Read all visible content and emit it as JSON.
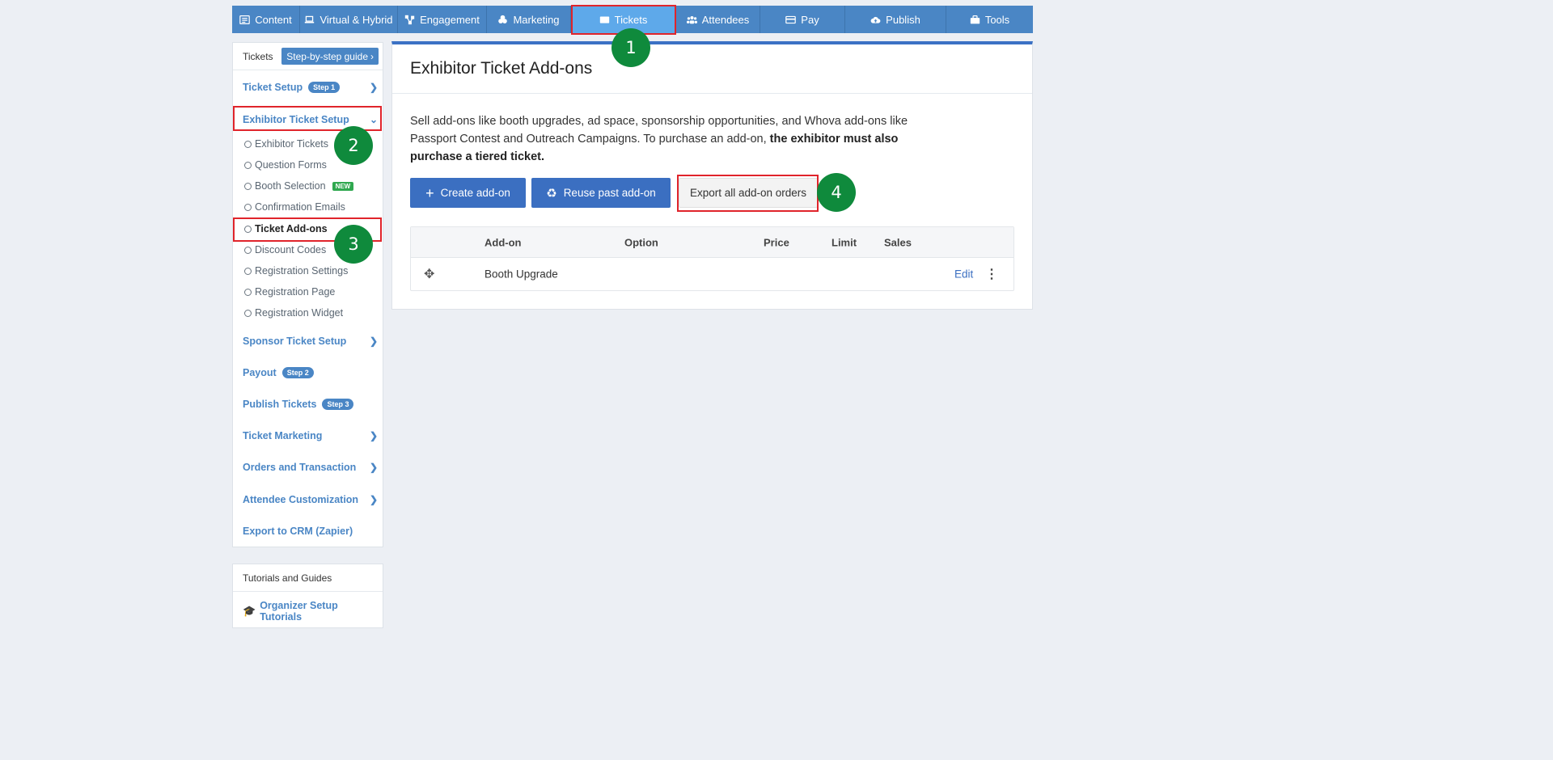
{
  "nav": {
    "tabs": [
      {
        "label": "Content",
        "icon": "list-icon"
      },
      {
        "label": "Virtual & Hybrid",
        "icon": "laptop-icon"
      },
      {
        "label": "Engagement",
        "icon": "network-icon"
      },
      {
        "label": "Marketing",
        "icon": "marketing-icon"
      },
      {
        "label": "Tickets",
        "icon": "ticket-icon",
        "active": true
      },
      {
        "label": "Attendees",
        "icon": "users-icon"
      },
      {
        "label": "Pay",
        "icon": "card-icon"
      },
      {
        "label": "Publish",
        "icon": "cloud-upload-icon"
      },
      {
        "label": "Tools",
        "icon": "toolbox-icon"
      }
    ]
  },
  "annotations": [
    "1",
    "2",
    "3",
    "4"
  ],
  "sidebar": {
    "header": "Tickets",
    "guide_label": "Step-by-step guide",
    "items": [
      {
        "label": "Ticket Setup",
        "step": "Step 1"
      },
      {
        "label": "Exhibitor Ticket Setup"
      },
      {
        "label": "Sponsor Ticket Setup"
      },
      {
        "label": "Payout",
        "step": "Step 2"
      },
      {
        "label": "Publish Tickets",
        "step": "Step 3"
      },
      {
        "label": "Ticket Marketing"
      },
      {
        "label": "Orders and Transaction"
      },
      {
        "label": "Attendee Customization"
      },
      {
        "label": "Export to CRM (Zapier)"
      }
    ],
    "subitems": [
      "Exhibitor Tickets",
      "Question Forms",
      "Booth Selection",
      "Confirmation Emails",
      "Ticket Add-ons",
      "Discount Codes",
      "Registration Settings",
      "Registration Page",
      "Registration Widget"
    ],
    "new_badge": "NEW"
  },
  "tutorials": {
    "header": "Tutorials and Guides",
    "link": "Organizer Setup Tutorials"
  },
  "main": {
    "title": "Exhibitor Ticket Add-ons",
    "desc_text": "Sell add-ons like booth upgrades, ad space, sponsorship opportunities, and Whova add-ons like Passport Contest and Outreach Campaigns. To purchase an add-on,",
    "desc_bold": "the exhibitor must also purchase a tiered ticket.",
    "buttons": {
      "create": "Create add-on",
      "reuse": "Reuse past add-on",
      "export": "Export all add-on orders"
    },
    "table": {
      "headers": [
        "Add-on",
        "Option",
        "Price",
        "Limit",
        "Sales"
      ],
      "rows": [
        {
          "addon": "Booth Upgrade",
          "option": "",
          "price": "",
          "limit": "",
          "sales": "",
          "action": "Edit"
        }
      ]
    }
  },
  "colors": {
    "nav_bg": "#4a86c5",
    "nav_active": "#5ea9ea",
    "primary": "#3b6fc1",
    "marker": "#0f8a3c",
    "highlight": "#e0242b"
  }
}
